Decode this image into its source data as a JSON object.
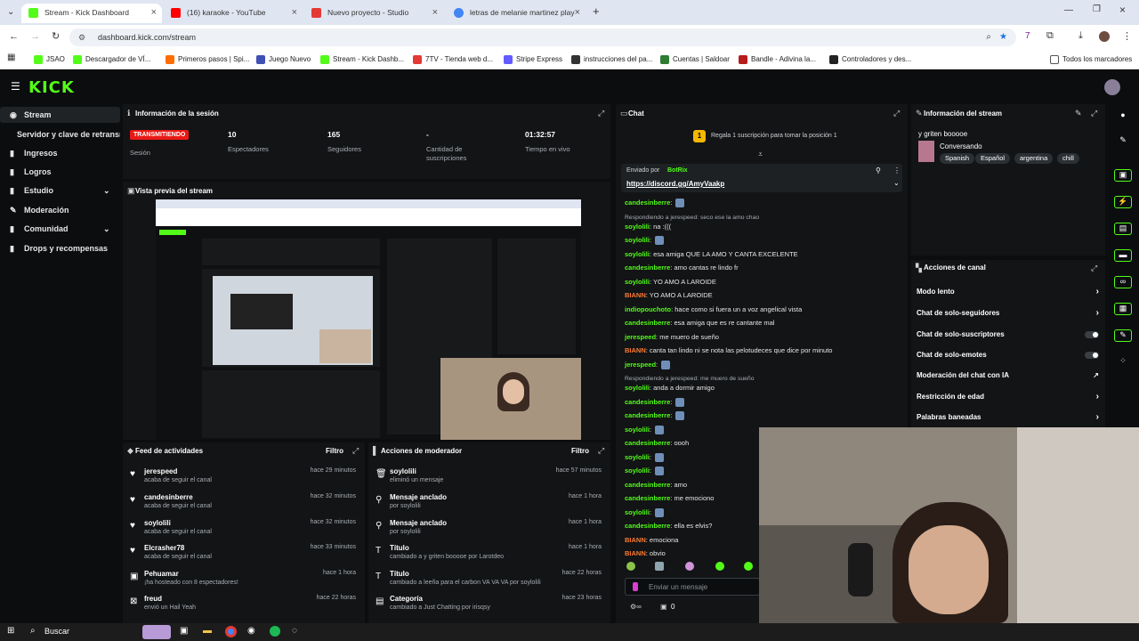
{
  "browser": {
    "tabs": [
      {
        "label": "Stream - Kick Dashboard",
        "fav": "#53fc18"
      },
      {
        "label": "(16) karaoke - YouTube",
        "fav": "#ff0000"
      },
      {
        "label": "Nuevo proyecto - Studio",
        "fav": "#e53935"
      },
      {
        "label": "letras de melanie martinez play",
        "fav": "#4285f4"
      }
    ],
    "new_tab": "+",
    "url": "dashboard.kick.com/stream",
    "bookmarks": [
      {
        "label": "JSAO",
        "color": "#53fc18"
      },
      {
        "label": "Descargador de VÍ...",
        "color": "#53fc18"
      },
      {
        "label": "Primeros pasos | Spi...",
        "color": "#ff6d00"
      },
      {
        "label": "Juego Nuevo",
        "color": "#3f51b5"
      },
      {
        "label": "Stream - Kick Dashb...",
        "color": "#53fc18"
      },
      {
        "label": "7TV - Tienda web d...",
        "color": "#e53935"
      },
      {
        "label": "Stripe Express",
        "color": "#635bff"
      },
      {
        "label": "instrucciones del pa...",
        "color": "#333333"
      },
      {
        "label": "Cuentas | Saldoar",
        "color": "#2e7d32"
      },
      {
        "label": "Bandle - Adivina la...",
        "color": "#b71c1c"
      },
      {
        "label": "Controladores y des...",
        "color": "#222222"
      }
    ],
    "all_bookmarks": "Todos los marcadores"
  },
  "app": {
    "logo": "KICK",
    "sidebar": [
      {
        "label": "Stream",
        "icon": "live-icon"
      },
      {
        "label": "Servidor y clave de retransmisión",
        "icon": ""
      },
      {
        "label": "Ingresos",
        "icon": "money-icon"
      },
      {
        "label": "Logros",
        "icon": "trophy-icon"
      },
      {
        "label": "Estudio",
        "icon": "studio-icon"
      },
      {
        "label": "Moderación",
        "icon": "wrench-icon"
      },
      {
        "label": "Comunidad",
        "icon": "community-icon"
      },
      {
        "label": "Drops y recompensas",
        "icon": "gift-icon"
      }
    ]
  },
  "session": {
    "title": "Información de la sesión",
    "status": "TRANSMITIENDO",
    "status_label": "Sesión",
    "viewers": "10",
    "viewers_label": "Espectadores",
    "followers": "165",
    "followers_label": "Seguidores",
    "subs": "-",
    "subs_label": "Cantidad de suscripciones",
    "live_time": "01:32:57",
    "live_time_label": "Tiempo en vivo"
  },
  "preview": {
    "title": "Vista previa del stream"
  },
  "feed": {
    "title": "Feed de actividades",
    "filter": "Filtro",
    "items": [
      {
        "name": "jerespeed",
        "sub": "acaba de seguir el canal",
        "time": "hace 29 minutos",
        "icon": "heart-icon"
      },
      {
        "name": "candesinberre",
        "sub": "acaba de seguir el canal",
        "time": "hace 32 minutos",
        "icon": "heart-icon"
      },
      {
        "name": "soylolili",
        "sub": "acaba de seguir el canal",
        "time": "hace 32 minutos",
        "icon": "heart-icon"
      },
      {
        "name": "Elcrasher78",
        "sub": "acaba de seguir el canal",
        "time": "hace 33 minutos",
        "icon": "heart-icon"
      },
      {
        "name": "Pehuamar",
        "sub": "¡ha hosteado con 8 espectadores!",
        "time": "hace 1 hora",
        "icon": "host-icon"
      },
      {
        "name": "freud",
        "sub": "envió un Hail Yeah",
        "time": "hace 22 horas",
        "icon": "gift-icon"
      }
    ]
  },
  "modactions": {
    "title": "Acciones de moderador",
    "filter": "Filtro",
    "items": [
      {
        "name": "soylolili",
        "sub": "eliminó un mensaje",
        "time": "hace 57 minutos",
        "icon": "trash-icon"
      },
      {
        "name": "Mensaje anclado",
        "sub": "por soylolili",
        "time": "hace 1 hora",
        "icon": "pin-icon"
      },
      {
        "name": "Mensaje anclado",
        "sub": "por soylolili",
        "time": "hace 1 hora",
        "icon": "pin-icon"
      },
      {
        "name": "Título",
        "sub": "cambiado a y griten booooe por Larotdeo",
        "time": "hace 1 hora",
        "icon": "title-icon"
      },
      {
        "name": "Título",
        "sub": "cambiado a leeña para el carbon VA VA VA por soylolili",
        "time": "hace 22 horas",
        "icon": "title-icon"
      },
      {
        "name": "Categoría",
        "sub": "cambiado a Just Chatting por irisqsy",
        "time": "hace 23 horas",
        "icon": "category-icon"
      }
    ]
  },
  "chat": {
    "title": "Chat",
    "gift_banner": "Regala 1 suscripción para tomar la posición 1",
    "pinned_by": "Enviado por",
    "pinned_user": "BotRix",
    "pinned_link": "https://discord.gg/AmyVaakp",
    "input_placeholder": "Enviar un mensaje",
    "bottom_count": "0",
    "lines": [
      {
        "user": "candesinberre",
        "text": "",
        "color": "#53fc18"
      },
      {
        "reply": "Respondiendo a jerespeed: seco ese la amo chao"
      },
      {
        "user": "soylolili",
        "text": "na :(((",
        "color": "#53fc18"
      },
      {
        "user": "soylolili",
        "text": "",
        "color": "#53fc18"
      },
      {
        "user": "soylolili",
        "text": "esa amiga QUE LA AMO Y CANTA EXCELENTE",
        "color": "#53fc18"
      },
      {
        "user": "candesinberre",
        "text": "amo cantas re lindo fr",
        "color": "#53fc18"
      },
      {
        "user": "soylolili",
        "text": "YO AMO A LAROIDE",
        "color": "#53fc18"
      },
      {
        "user": "BIANN",
        "text": "YO AMO A LAROIDE",
        "color": "#ff7a2f"
      },
      {
        "user": "indiopouchoto",
        "text": "hace como si fuera un a voz angelical vista",
        "color": "#53fc18"
      },
      {
        "user": "candesinberre",
        "text": "esa amiga que es re cantante mal",
        "color": "#53fc18"
      },
      {
        "user": "jerespeed",
        "text": "me muero de sueño",
        "color": "#53fc18"
      },
      {
        "user": "BIANN",
        "text": "canta tan lindo ni se nota las pelotudeces que dice por minuto",
        "color": "#ff7a2f"
      },
      {
        "user": "jerespeed",
        "text": "",
        "color": "#53fc18"
      },
      {
        "reply": "Respondiendo a jerespeed: me muero de sueño"
      },
      {
        "user": "soylolili",
        "text": "anda a dormir amigo",
        "color": "#53fc18"
      },
      {
        "user": "candesinberre",
        "text": "",
        "color": "#53fc18"
      },
      {
        "user": "candesinberre",
        "text": "",
        "color": "#53fc18"
      },
      {
        "user": "soylolili",
        "text": "",
        "color": "#53fc18"
      },
      {
        "user": "candesinberre",
        "text": "oooh",
        "color": "#53fc18"
      },
      {
        "user": "soylolili",
        "text": "",
        "color": "#53fc18"
      },
      {
        "user": "soylolili",
        "text": "",
        "color": "#53fc18"
      },
      {
        "user": "candesinberre",
        "text": "amo",
        "color": "#53fc18"
      },
      {
        "user": "candesinberre",
        "text": "me emociono",
        "color": "#53fc18"
      },
      {
        "user": "soylolili",
        "text": "",
        "color": "#53fc18"
      },
      {
        "user": "candesinberre",
        "text": "ella es elvis?",
        "color": "#53fc18"
      },
      {
        "user": "BIANN",
        "text": "emociona",
        "color": "#ff7a2f"
      },
      {
        "user": "BIANN",
        "text": "obvio",
        "color": "#ff7a2f"
      }
    ]
  },
  "streaminfo": {
    "title": "Información del stream",
    "stream_title": "y griten booooe",
    "category": "Conversando",
    "tags": [
      "Spanish",
      "Español",
      "argentina",
      "chill"
    ]
  },
  "channel": {
    "title": "Acciones de canal",
    "items": [
      {
        "label": "Modo lento",
        "kind": "arrow"
      },
      {
        "label": "Chat de solo-seguidores",
        "kind": "arrow"
      },
      {
        "label": "Chat de solo-suscriptores",
        "kind": "toggle"
      },
      {
        "label": "Chat de solo-emotes",
        "kind": "toggle"
      },
      {
        "label": "Moderación del chat con IA",
        "kind": "external"
      },
      {
        "label": "Restricción de edad",
        "kind": "arrow"
      },
      {
        "label": "Palabras baneadas",
        "kind": "arrow"
      }
    ]
  },
  "taskbar": {
    "search": "Buscar"
  }
}
